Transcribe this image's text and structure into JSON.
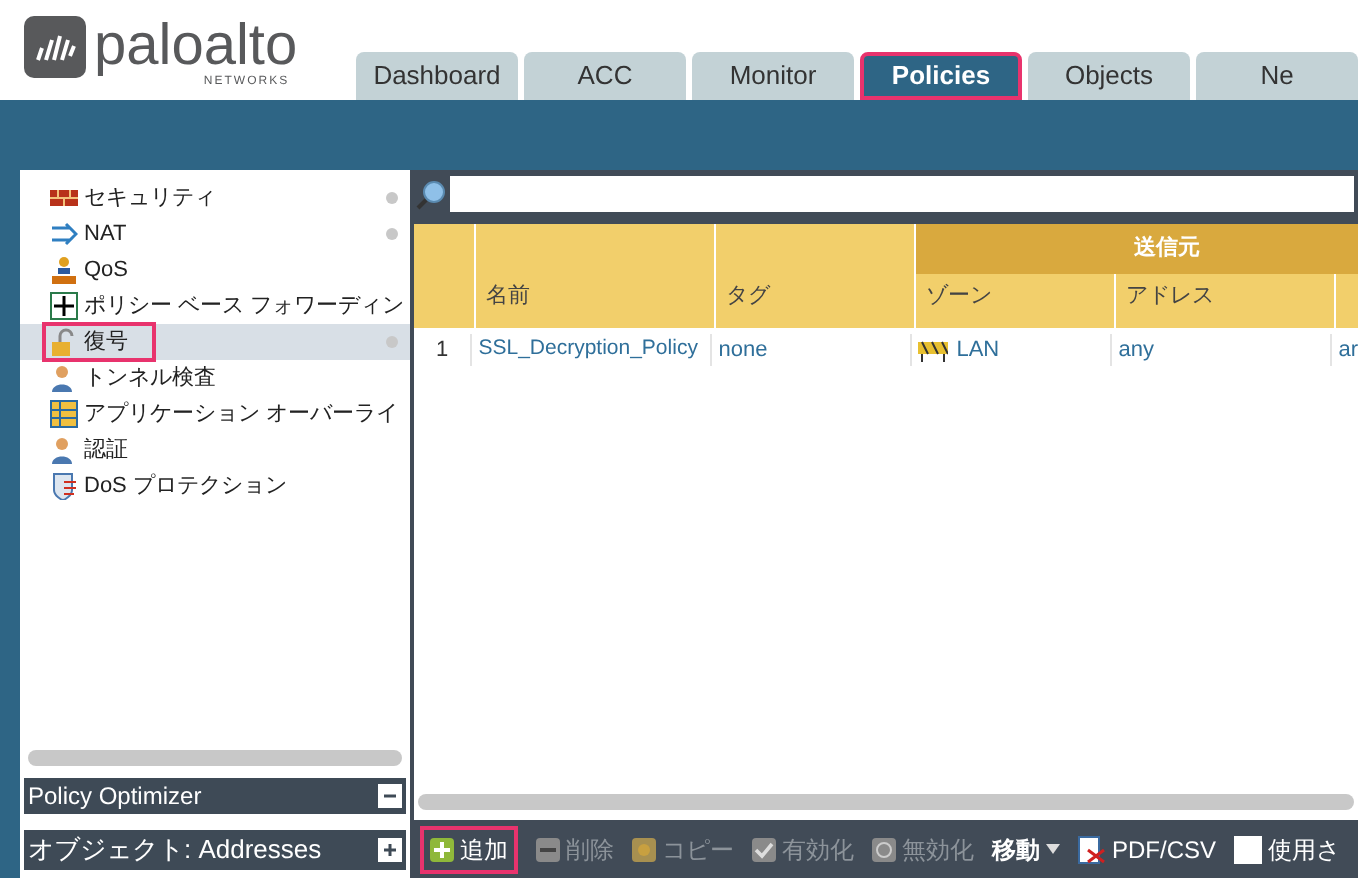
{
  "logo": {
    "name": "paloalto",
    "sub": "NETWORKS"
  },
  "tabs": [
    {
      "label": "Dashboard",
      "selected": false,
      "highlighted": false
    },
    {
      "label": "ACC",
      "selected": false,
      "highlighted": false
    },
    {
      "label": "Monitor",
      "selected": false,
      "highlighted": false
    },
    {
      "label": "Policies",
      "selected": true,
      "highlighted": true
    },
    {
      "label": "Objects",
      "selected": false,
      "highlighted": false
    },
    {
      "label": "Ne",
      "selected": false,
      "highlighted": false
    }
  ],
  "sidebar": {
    "items": [
      {
        "label": "セキュリティ",
        "kind": "wall",
        "dot": true,
        "selected": false,
        "highlighted": false
      },
      {
        "label": "NAT",
        "kind": "nat",
        "dot": true,
        "selected": false,
        "highlighted": false
      },
      {
        "label": "QoS",
        "kind": "qos",
        "dot": false,
        "selected": false,
        "highlighted": false
      },
      {
        "label": "ポリシー ベース フォワーディン",
        "kind": "pbf",
        "dot": false,
        "selected": false,
        "highlighted": false
      },
      {
        "label": "復号",
        "kind": "lock",
        "dot": true,
        "selected": true,
        "highlighted": true
      },
      {
        "label": "トンネル検査",
        "kind": "user",
        "dot": false,
        "selected": false,
        "highlighted": false
      },
      {
        "label": "アプリケーション オーバーライ",
        "kind": "grid",
        "dot": false,
        "selected": false,
        "highlighted": false
      },
      {
        "label": "認証",
        "kind": "user",
        "dot": false,
        "selected": false,
        "highlighted": false
      },
      {
        "label": "DoS プロテクション",
        "kind": "shield",
        "dot": false,
        "selected": false,
        "highlighted": false
      }
    ]
  },
  "panels": [
    {
      "title": "Policy Optimizer",
      "expanded": true
    },
    {
      "title": "オブジェクト: Addresses",
      "expanded": false
    }
  ],
  "table": {
    "group": "送信元",
    "columns": [
      "名前",
      "タグ",
      "ゾーン",
      "アドレス"
    ],
    "rows": [
      {
        "index": "1",
        "name": "SSL_Decryption_Policy",
        "tag": "none",
        "zone": "LAN",
        "address": "any",
        "column_6": "ar"
      }
    ]
  },
  "toolbar": [
    {
      "label": "追加",
      "kind": "add",
      "disabled": false,
      "highlighted": true
    },
    {
      "label": "削除",
      "kind": "delete",
      "disabled": true,
      "highlighted": false
    },
    {
      "label": "コピー",
      "kind": "copy",
      "disabled": true,
      "highlighted": false
    },
    {
      "label": "有効化",
      "kind": "enable",
      "disabled": true,
      "highlighted": false
    },
    {
      "label": "無効化",
      "kind": "disable",
      "disabled": true,
      "highlighted": false
    },
    {
      "label": "移動",
      "kind": "menu",
      "disabled": false,
      "highlighted": false
    },
    {
      "label": "PDF/CSV",
      "kind": "pdf",
      "disabled": false,
      "highlighted": false
    },
    {
      "label": "使用さ",
      "kind": "checkbox",
      "checked": false,
      "disabled": false,
      "highlighted": false
    }
  ]
}
